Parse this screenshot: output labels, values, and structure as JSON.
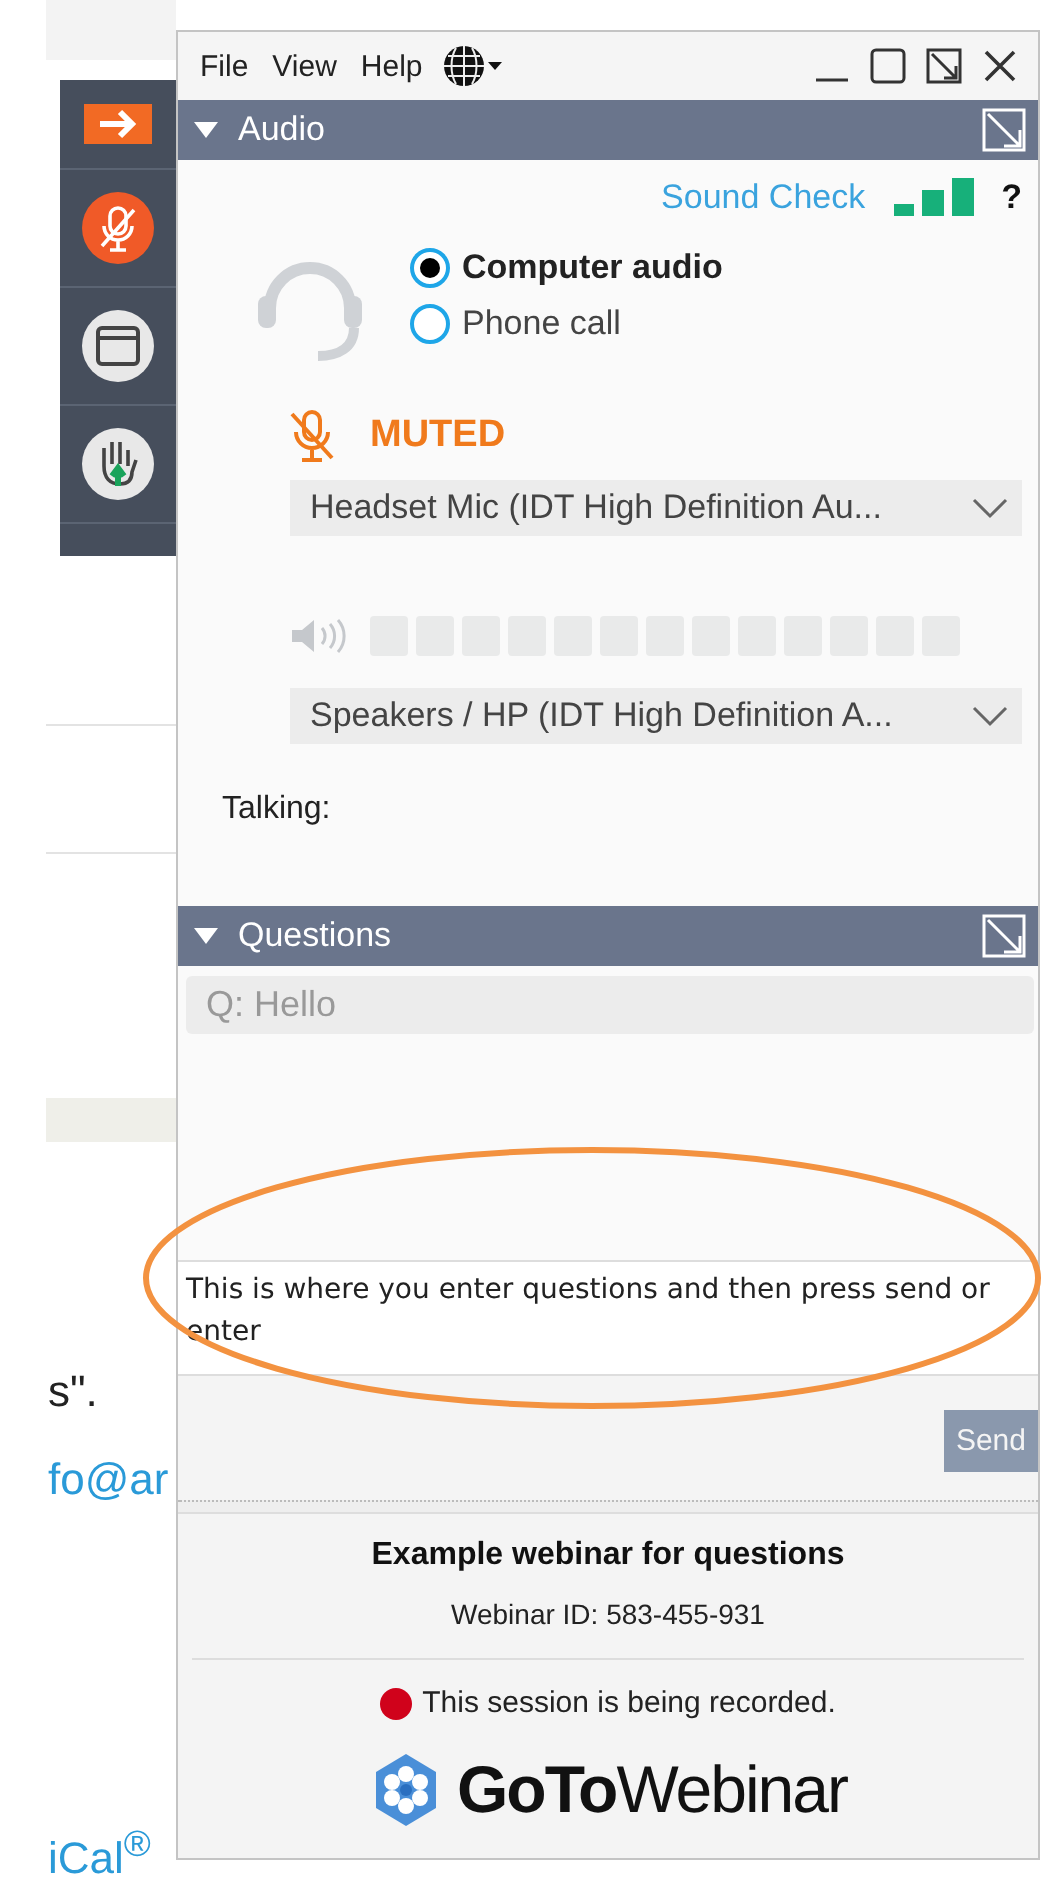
{
  "background_page": {
    "texts": [
      {
        "kind": "text",
        "text": "s\"."
      },
      {
        "kind": "link",
        "text": "fo@ar"
      },
      {
        "kind": "link",
        "text": "iCal$^{®}$"
      }
    ]
  },
  "menu": [
    "File",
    "View",
    "Help"
  ],
  "audio": {
    "title": "Audio",
    "expanded": true,
    "sound_check": "Sound Check",
    "help": "?",
    "options": [
      {
        "label": "Computer audio",
        "selected": true
      },
      {
        "label": "Phone call",
        "selected": false
      }
    ],
    "mic": {
      "muted": true,
      "status": "MUTED",
      "device": "Headset Mic (IDT High Definition Au..."
    },
    "speaker": {
      "device": "Speakers / HP (IDT High Definition A..."
    },
    "talking_label": "Talking:"
  },
  "questions": {
    "title": "Questions",
    "expanded": true,
    "items": [
      "Q: Hello"
    ],
    "input": {
      "value": "This is where you enter questions and then press send or enter"
    },
    "send": "Send"
  },
  "footer": {
    "webinar_title": "Example webinar for questions",
    "webinar_id": "Webinar ID: 583-455-931",
    "recording": {
      "on": true,
      "text": "This session is being recorded."
    },
    "logo": "**GoTo**Webinar"
  }
}
